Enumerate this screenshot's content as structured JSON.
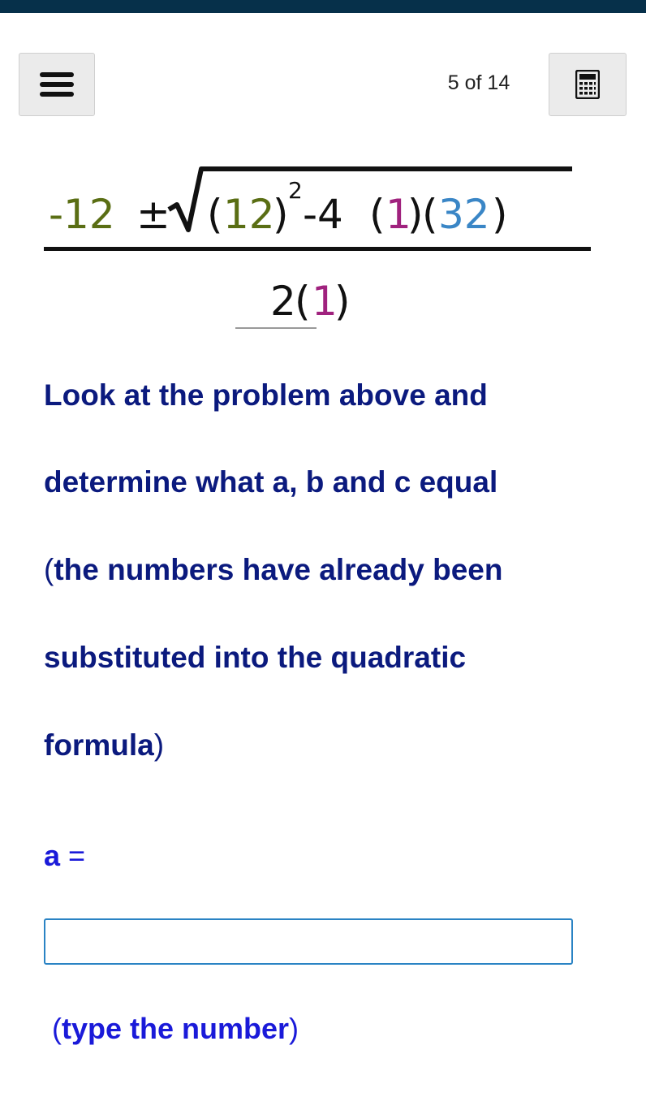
{
  "header": {
    "counter": "5 of 14",
    "menu_icon": "hamburger-menu-icon",
    "calculator_icon": "calculator-icon"
  },
  "formula": {
    "minus_b": "-12",
    "plus_minus": "±",
    "b": "12",
    "squared": "2",
    "minus_four": "-4",
    "a": "1",
    "c": "32",
    "denominator_two": "2",
    "colors": {
      "b": "#5a6e14",
      "a": "#a0227e",
      "c": "#3a86c6",
      "text": "#111111"
    }
  },
  "question": {
    "line1": "Look at the problem above and",
    "line2": "determine what a, b and c equal",
    "line3_open": "(",
    "line3_rest": "the numbers have already been",
    "line4": "substituted into the quadratic",
    "line5_main": "formula",
    "line5_close": ")"
  },
  "answer": {
    "label_var": "a",
    "label_eq": "=",
    "value": "",
    "placeholder": ""
  },
  "hint": {
    "open": "(",
    "main": "type the number",
    "close": ")"
  }
}
